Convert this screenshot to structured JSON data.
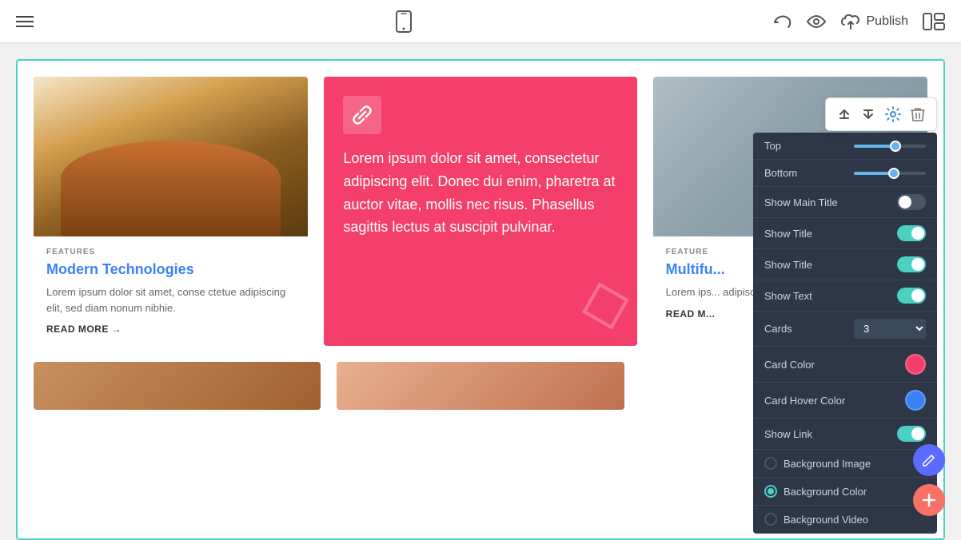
{
  "topbar": {
    "publish_label": "Publish"
  },
  "settings_panel": {
    "top_label": "Top",
    "bottom_label": "Bottom",
    "show_main_title_label": "Show Main Title",
    "show_title_1_label": "Show Title",
    "show_title_2_label": "Show Title",
    "show_text_label": "Show Text",
    "cards_label": "Cards",
    "cards_value": "3",
    "card_color_label": "Card Color",
    "card_hover_color_label": "Card Hover Color",
    "show_link_label": "Show Link",
    "background_image_label": "Background Image",
    "background_color_label": "Background Color",
    "background_video_label": "Background Video"
  },
  "cards": [
    {
      "category": "FEATURES",
      "title": "Modern Technologies",
      "text": "Lorem ipsum dolor sit amet, conse ctetue adipiscing elit, sed diam nonum nibhie.",
      "link": "READ MORE →"
    },
    {
      "type": "featured",
      "text": "Lorem ipsum dolor sit amet, consectetur adipiscing elit. Donec dui enim, pharetra at auctor vitae, mollis nec risus. Phasellus sagittis lectus at suscipit pulvinar."
    },
    {
      "category": "FEATURE",
      "title": "Multifu...",
      "text": "Lorem ips... adipiscing...",
      "link": "READ M..."
    }
  ],
  "widget_toolbar": {
    "up_label": "↑",
    "down_label": "↓",
    "settings_label": "⚙",
    "delete_label": "🗑"
  },
  "fab": {
    "edit_icon": "✏",
    "add_icon": "+"
  }
}
